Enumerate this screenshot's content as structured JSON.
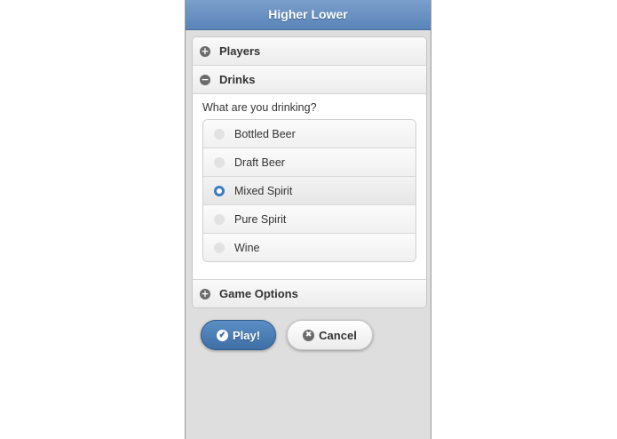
{
  "header": {
    "title": "Higher Lower"
  },
  "sections": {
    "players": {
      "label": "Players",
      "icon": "plus-circle-icon"
    },
    "drinks": {
      "label": "Drinks",
      "icon": "minus-circle-icon",
      "question": "What are you drinking?",
      "options": [
        {
          "label": "Bottled Beer",
          "checked": false
        },
        {
          "label": "Draft Beer",
          "checked": false
        },
        {
          "label": "Mixed Spirit",
          "checked": true
        },
        {
          "label": "Pure Spirit",
          "checked": false
        },
        {
          "label": "Wine",
          "checked": false
        }
      ]
    },
    "game_options": {
      "label": "Game Options",
      "icon": "plus-circle-icon"
    }
  },
  "buttons": {
    "play": {
      "label": "Play!",
      "icon": "check-icon"
    },
    "cancel": {
      "label": "Cancel",
      "icon": "delete-icon"
    }
  },
  "colors": {
    "accent": "#3e6fa5",
    "header": "#5a84b8"
  }
}
